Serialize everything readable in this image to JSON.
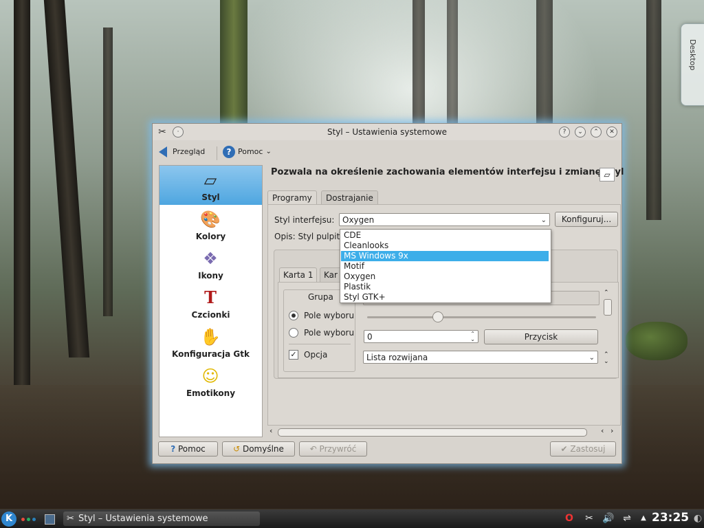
{
  "desktop": {
    "tab_label": "Desktop"
  },
  "window": {
    "title": "Styl – Ustawienia systemowe",
    "title_buttons": [
      "?",
      "⌄",
      "⌃",
      "✕"
    ]
  },
  "toolbar": {
    "back_label": "Przegląd",
    "help_label": "Pomoc"
  },
  "sidebar": {
    "items": [
      {
        "label": "Styl",
        "icon": "style-brush-icon"
      },
      {
        "label": "Kolory",
        "icon": "colors-palette-icon"
      },
      {
        "label": "Ikony",
        "icon": "icons-icon"
      },
      {
        "label": "Czcionki",
        "icon": "fonts-icon"
      },
      {
        "label": "Konfiguracja Gtk",
        "icon": "gtk-icon"
      },
      {
        "label": "Emotikony",
        "icon": "smiley-icon"
      }
    ]
  },
  "content": {
    "heading": "Pozwala na określenie zachowania elementów interfejsu i zmianę Styl",
    "tabs": [
      "Programy",
      "Dostrajanie"
    ],
    "style_label": "Styl interfejsu:",
    "style_value": "Oxygen",
    "configure_button": "Konfiguruj...",
    "description": "Opis: Styl pulpit",
    "dropdown_options": [
      "CDE",
      "Cleanlooks",
      "MS Windows 9x",
      "Motif",
      "Oxygen",
      "Plastik",
      "Styl GTK+"
    ],
    "dropdown_selected": "MS Windows 9x"
  },
  "preview": {
    "tabs": [
      "Karta 1",
      "Kar"
    ],
    "group_title": "Grupa",
    "radio1": "Pole wyboru",
    "radio2": "Pole wyboru",
    "checkbox": "Opcja",
    "spin_value": "0",
    "button": "Przycisk",
    "combo": "Lista rozwijana"
  },
  "buttons": {
    "help": "Pomoc",
    "defaults": "Domyślne",
    "reset": "Przywróć",
    "apply": "Zastosuj"
  },
  "taskbar": {
    "task_title": "Styl – Ustawienia systemowe",
    "clock": "23:25"
  }
}
